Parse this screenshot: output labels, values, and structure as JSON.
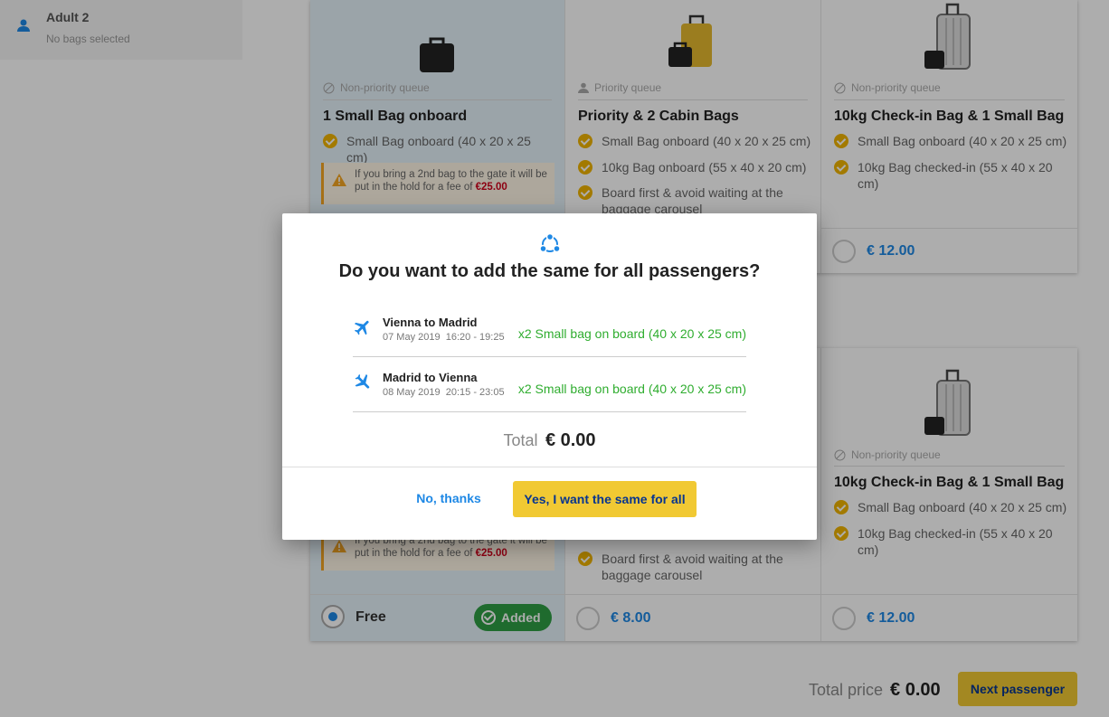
{
  "sidebar": {
    "passenger_name": "Adult 2",
    "passenger_status": "No bags selected"
  },
  "options_top": [
    {
      "queue": "Non-priority queue",
      "title": "1 Small Bag onboard",
      "features": [
        "Small Bag onboard (40 x 20 x 25 cm)"
      ],
      "warning": {
        "text": "If you bring a 2nd bag to the gate it will be put in the hold for a fee of",
        "fee": "€25.00"
      }
    },
    {
      "queue": "Priority queue",
      "title": "Priority & 2 Cabin Bags",
      "features": [
        "Small Bag onboard (40 x 20 x 25 cm)",
        "10kg Bag onboard (55 x 40 x 20 cm)",
        "Board first & avoid waiting at the baggage carousel"
      ]
    },
    {
      "queue": "Non-priority queue",
      "title": "10kg Check-in Bag & 1 Small Bag",
      "features": [
        "Small Bag onboard (40 x 20 x 25 cm)",
        "10kg Bag checked-in (55 x 40 x 20 cm)"
      ],
      "price": "€ 12.00"
    }
  ],
  "options_bottom": [
    {
      "warning": {
        "text": "If you bring a 2nd bag to the gate it will be put in the hold for a fee of",
        "fee": "€25.00"
      },
      "price": "Free",
      "added_label": "Added"
    },
    {
      "features": [
        "Board first & avoid waiting at the baggage carousel"
      ],
      "price": "€ 8.00"
    },
    {
      "queue": "Non-priority queue",
      "title": "10kg Check-in Bag & 1 Small Bag",
      "features": [
        "Small Bag onboard (40 x 20 x 25 cm)",
        "10kg Bag checked-in (55 x 40 x 20 cm)"
      ],
      "price": "€ 12.00"
    }
  ],
  "footer": {
    "total_label": "Total price",
    "total_value": "€ 0.00",
    "next_label": "Next passenger"
  },
  "modal": {
    "title": "Do you want to add the same for all passengers?",
    "flights": [
      {
        "route": "Vienna to Madrid",
        "date": "07 May 2019",
        "time": "16:20 - 19:25",
        "bags": "x2 Small bag on board (40 x 20 x 25 cm)"
      },
      {
        "route": "Madrid to Vienna",
        "date": "08 May 2019",
        "time": "20:15 - 23:05",
        "bags": "x2 Small bag on board (40 x 20 x 25 cm)"
      }
    ],
    "total_label": "Total",
    "total_value": "€ 0.00",
    "no_label": "No, thanks",
    "yes_label": "Yes, I want the same for all"
  },
  "colors": {
    "brand_blue": "#073590",
    "accent_yellow": "#f1c933",
    "link_blue": "#1e88e5",
    "success_green": "#2fad2f"
  }
}
